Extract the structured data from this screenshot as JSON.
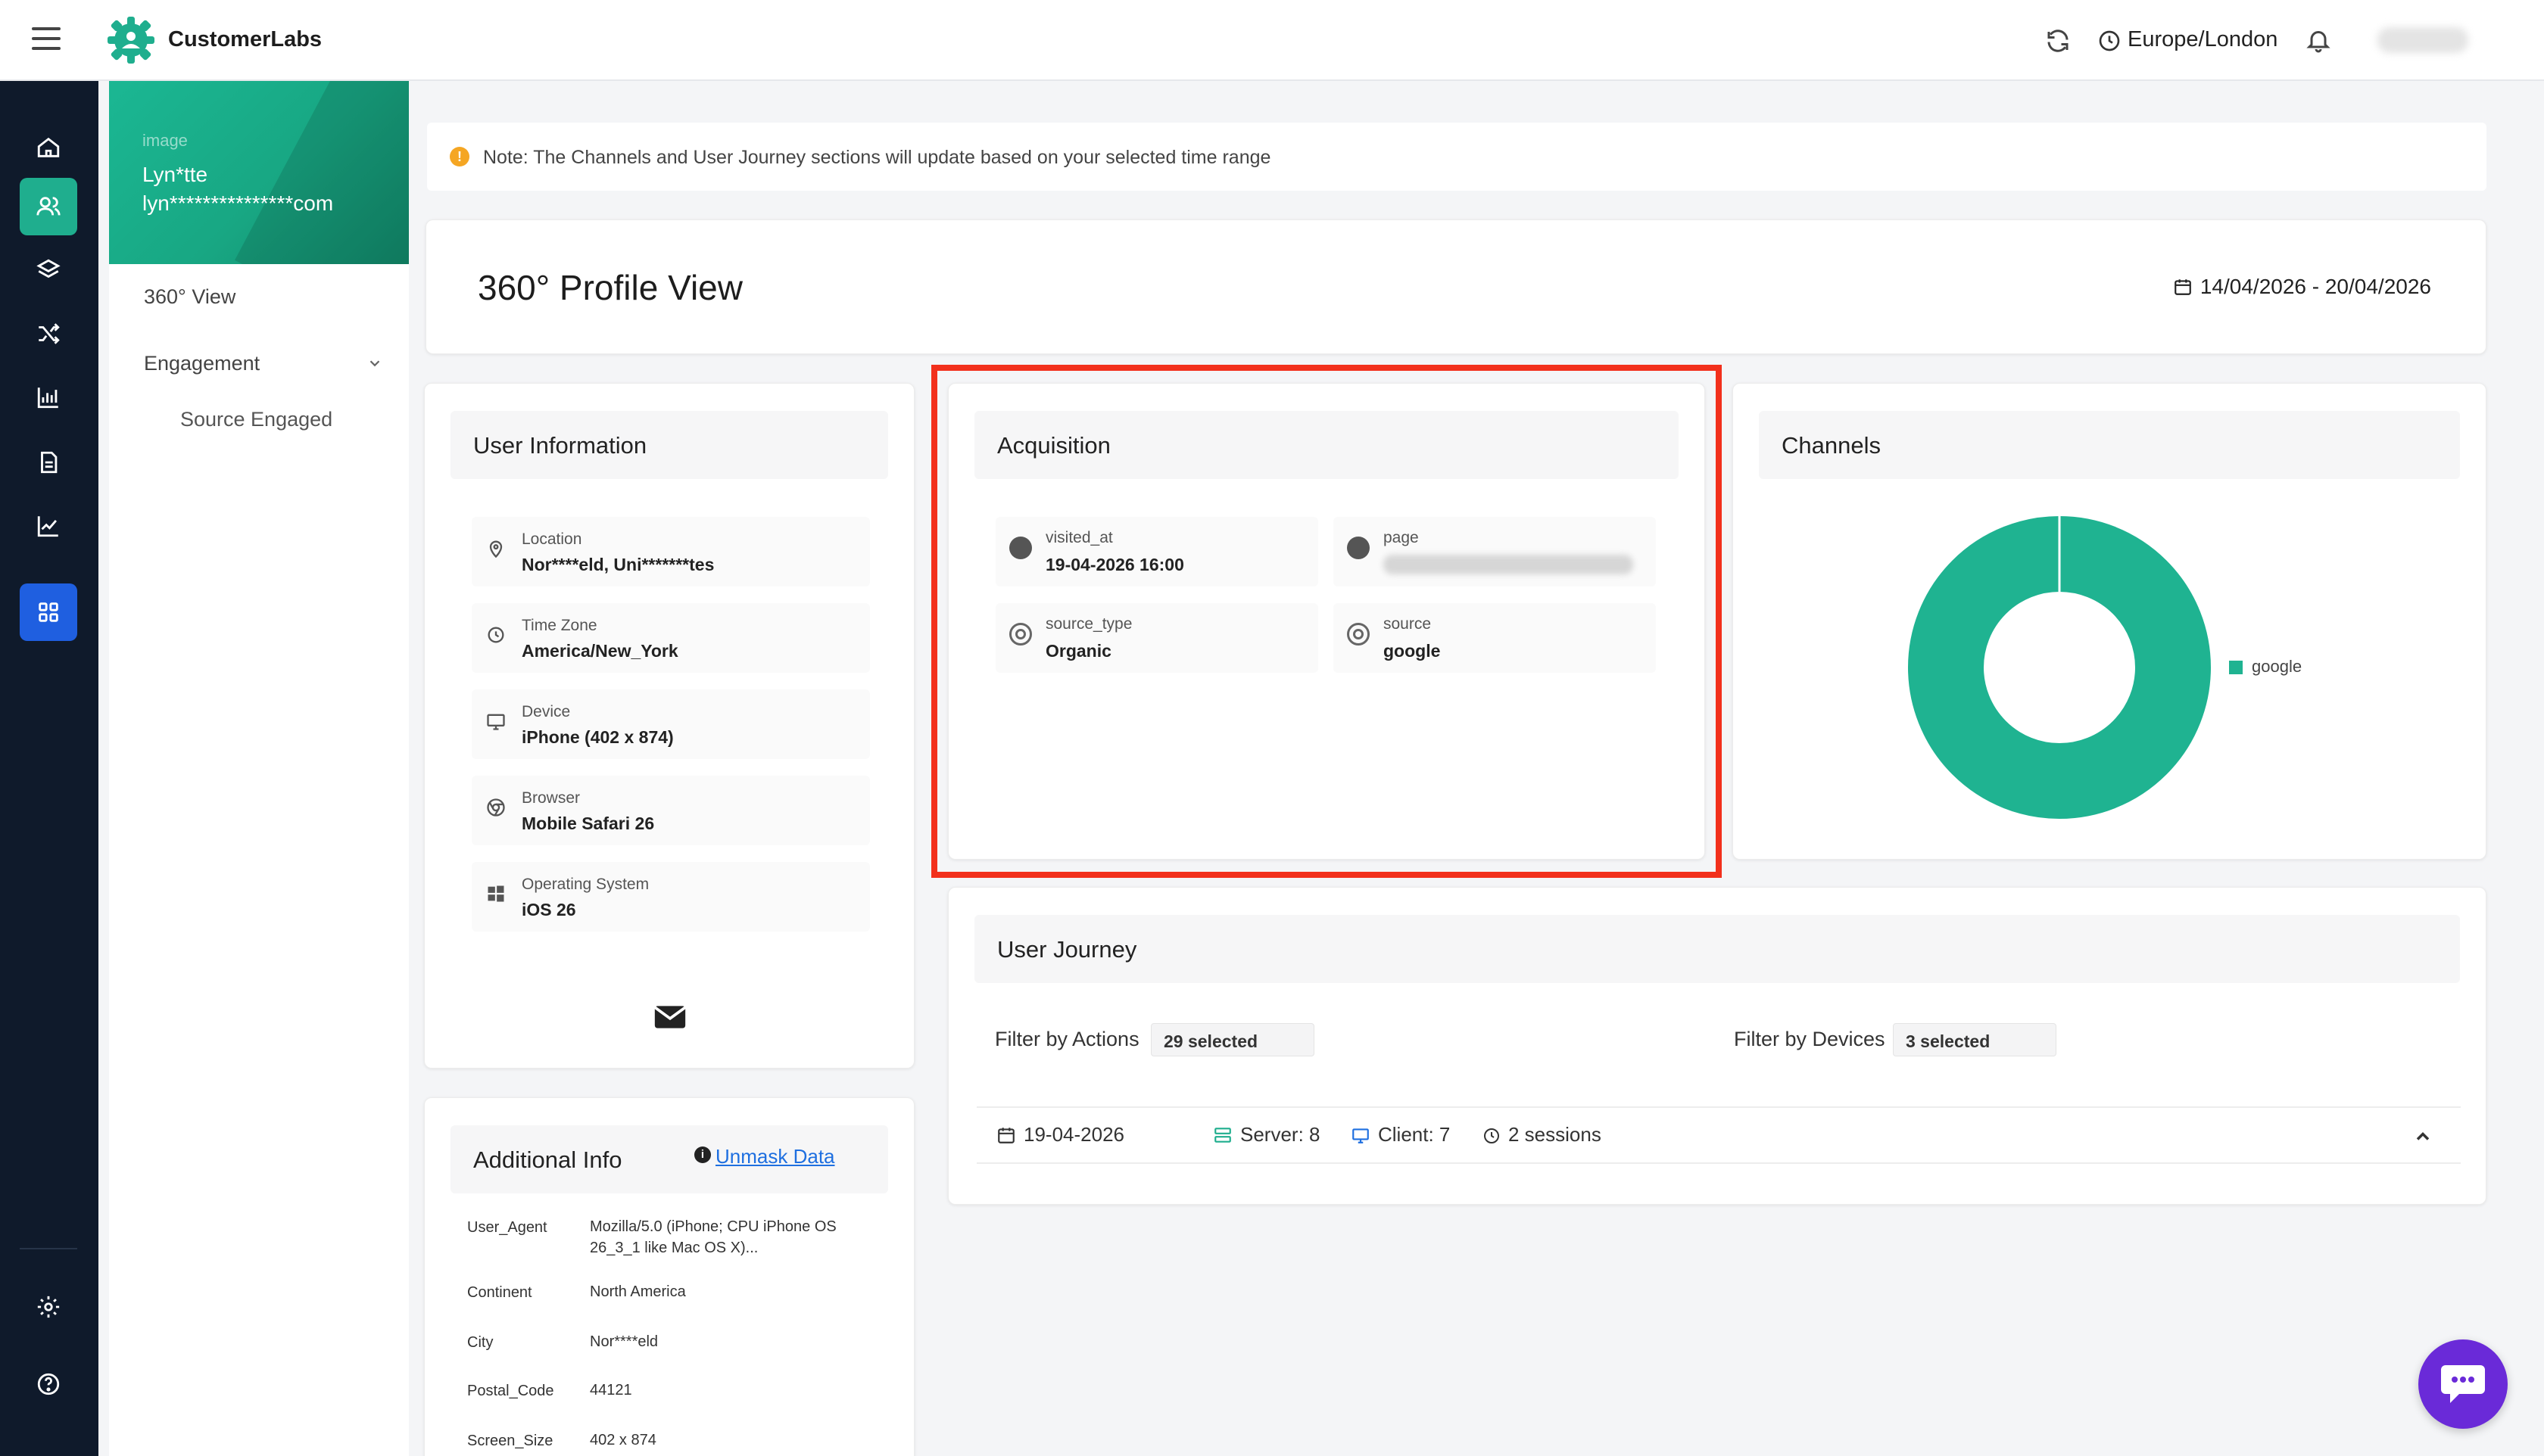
{
  "app": {
    "brand": "CustomerLabs"
  },
  "topbar": {
    "timezone": "Europe/London"
  },
  "profile": {
    "name": "Lyn*tte",
    "email": "lyn***************com",
    "image_alt": "image"
  },
  "subnav": {
    "view_360": "360° View",
    "engagement": "Engagement",
    "source_engaged": "Source Engaged"
  },
  "note": {
    "text": "Note: The Channels and User Journey sections will update based on your selected time range"
  },
  "header": {
    "title": "360° Profile View",
    "date_range": "14/04/2026 - 20/04/2026"
  },
  "user_info": {
    "title": "User Information",
    "rows": [
      {
        "label": "Location",
        "value": "Nor****eld, Uni*******tes",
        "icon": "location-pin-icon"
      },
      {
        "label": "Time Zone",
        "value": "America/New_York",
        "icon": "clock-icon"
      },
      {
        "label": "Device",
        "value": "iPhone (402 x 874)",
        "icon": "monitor-icon"
      },
      {
        "label": "Browser",
        "value": "Mobile Safari 26",
        "icon": "chrome-icon"
      },
      {
        "label": "Operating System",
        "value": "iOS 26",
        "icon": "windows-icon"
      }
    ]
  },
  "acquisition": {
    "title": "Acquisition",
    "rows": [
      {
        "label": "visited_at",
        "value": "19-04-2026 16:00"
      },
      {
        "label": "page",
        "value": ""
      },
      {
        "label": "source_type",
        "value": "Organic"
      },
      {
        "label": "source",
        "value": "google"
      }
    ]
  },
  "channels": {
    "title": "Channels",
    "legend": "google",
    "color": "#1fb391"
  },
  "chart_data": {
    "type": "pie",
    "categories": [
      "google"
    ],
    "values": [
      100
    ]
  },
  "journey": {
    "title": "User Journey",
    "filter_actions_label": "Filter by Actions",
    "filter_actions_value": "29 selected",
    "filter_devices_label": "Filter by Devices",
    "filter_devices_value": "3 selected",
    "date": "19-04-2026",
    "server": "Server: 8",
    "client": "Client: 7",
    "sessions": "2 sessions"
  },
  "additional": {
    "title": "Additional Info",
    "unmask": "Unmask Data",
    "rows": [
      {
        "key": "User_Agent",
        "value": "Mozilla/5.0 (iPhone; CPU iPhone OS 26_3_1 like Mac OS X)..."
      },
      {
        "key": "Continent",
        "value": "North America"
      },
      {
        "key": "City",
        "value": "Nor****eld"
      },
      {
        "key": "Postal_Code",
        "value": "44121"
      },
      {
        "key": "Screen_Size",
        "value": "402 x 874"
      }
    ]
  }
}
